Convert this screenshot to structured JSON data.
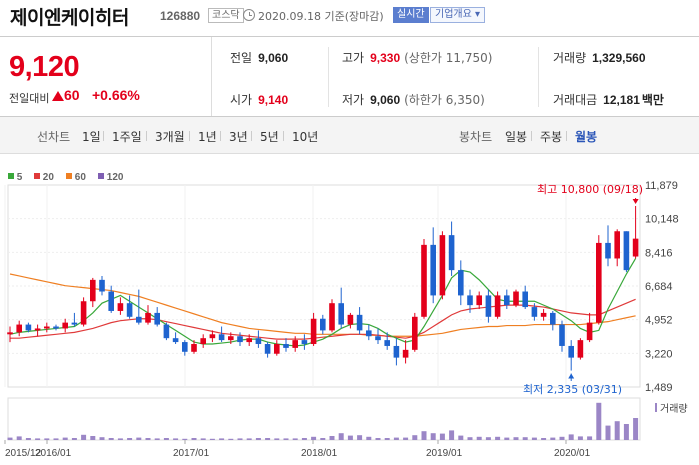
{
  "header": {
    "company_name": "제이엔케이히터",
    "stock_code": "126880",
    "market": "코스닥",
    "date_text": "2020.09.18 기준(장마감)",
    "realtime_label": "실시간",
    "overview_label": "기업개요 ▾"
  },
  "price": {
    "current": "9,120",
    "change_label": "전일대비",
    "change": "60",
    "change_pct": "+0.66%"
  },
  "stats": {
    "prev_close_label": "전일",
    "prev_close": "9,060",
    "high_label": "고가",
    "high": "9,330",
    "upper_limit": "(상한가 11,750)",
    "volume_label": "거래량",
    "volume": "1,329,560",
    "open_label": "시가",
    "open": "9,140",
    "low_label": "저가",
    "low": "9,060",
    "lower_limit": "(하한가 6,350)",
    "trade_value_label": "거래대금",
    "trade_value": "12,181",
    "trade_value_unit": "백만"
  },
  "toolbar": {
    "linechart_label": "선차트",
    "periods": [
      "1일",
      "1주일",
      "3개월",
      "1년",
      "3년",
      "5년",
      "10년"
    ],
    "candle_label": "봉차트",
    "candles": [
      "일봉",
      "주봉",
      "월봉"
    ],
    "active_candle": "월봉"
  },
  "legend": [
    {
      "label": "5",
      "color": "#39a83a"
    },
    {
      "label": "20",
      "color": "#e03a3a"
    },
    {
      "label": "60",
      "color": "#ef7f22"
    },
    {
      "label": "120",
      "color": "#7f5fb3"
    }
  ],
  "colors": {
    "up": "#e3001b",
    "down": "#1e63cf",
    "volume": "#9b86c6"
  },
  "chart_data": {
    "type": "candlestick",
    "period": "monthly",
    "ylim": [
      1489,
      11879
    ],
    "y_ticks": [
      "11,879",
      "10,148",
      "8,416",
      "6,684",
      "4,952",
      "3,220",
      "1,489"
    ],
    "x_ticks": [
      "2015/12",
      "2016/01",
      "2017/01",
      "2018/01",
      "2019/01",
      "2020/01"
    ],
    "max_annotation": "최고 10,800 (09/18)",
    "min_annotation": "최저 2,335 (03/31)",
    "volume_label": "거래량",
    "candles": [
      [
        4200,
        4600,
        3800,
        4300
      ],
      [
        4300,
        4900,
        4100,
        4700
      ],
      [
        4700,
        4800,
        4300,
        4400
      ],
      [
        4400,
        4700,
        4100,
        4500
      ],
      [
        4500,
        4800,
        4300,
        4600
      ],
      [
        4600,
        4700,
        4400,
        4500
      ],
      [
        4500,
        5000,
        4300,
        4800
      ],
      [
        4800,
        5300,
        4600,
        4700
      ],
      [
        4700,
        6100,
        4600,
        5900
      ],
      [
        5900,
        7100,
        5600,
        7000
      ],
      [
        7000,
        7200,
        6200,
        6400
      ],
      [
        6400,
        6700,
        5300,
        5400
      ],
      [
        5400,
        6100,
        5200,
        5800
      ],
      [
        5800,
        6200,
        5000,
        5100
      ],
      [
        5100,
        6500,
        4700,
        4800
      ],
      [
        4800,
        5700,
        4700,
        5300
      ],
      [
        5300,
        5600,
        4600,
        4700
      ],
      [
        4700,
        4800,
        3900,
        4000
      ],
      [
        4000,
        4300,
        3700,
        3800
      ],
      [
        3800,
        3900,
        3100,
        3300
      ],
      [
        3300,
        3900,
        3200,
        3700
      ],
      [
        3700,
        4200,
        3500,
        4000
      ],
      [
        4000,
        4400,
        3800,
        4200
      ],
      [
        4200,
        4600,
        3800,
        3900
      ],
      [
        3900,
        4300,
        3700,
        4100
      ],
      [
        4100,
        4300,
        3600,
        3800
      ],
      [
        3800,
        4200,
        3600,
        4000
      ],
      [
        4000,
        4400,
        3500,
        3700
      ],
      [
        3700,
        3800,
        3000,
        3200
      ],
      [
        3200,
        3900,
        3100,
        3700
      ],
      [
        3700,
        4000,
        3300,
        3500
      ],
      [
        3500,
        4100,
        3300,
        3900
      ],
      [
        3900,
        4200,
        3400,
        3700
      ],
      [
        3700,
        5300,
        3600,
        5000
      ],
      [
        5000,
        5200,
        4200,
        4400
      ],
      [
        4400,
        6000,
        4300,
        5800
      ],
      [
        5800,
        6600,
        4500,
        4700
      ],
      [
        4700,
        5300,
        4500,
        5200
      ],
      [
        5200,
        5600,
        4200,
        4400
      ],
      [
        4400,
        4700,
        3900,
        4100
      ],
      [
        4100,
        4500,
        3700,
        3900
      ],
      [
        3900,
        4300,
        3400,
        3600
      ],
      [
        3600,
        4000,
        2600,
        3000
      ],
      [
        3000,
        3900,
        2700,
        3400
      ],
      [
        3400,
        5300,
        3300,
        5100
      ],
      [
        5100,
        9100,
        5000,
        8800
      ],
      [
        8800,
        9700,
        5800,
        6200
      ],
      [
        6200,
        9500,
        6000,
        9300
      ],
      [
        9300,
        10000,
        7200,
        7500
      ],
      [
        7500,
        8000,
        5700,
        6200
      ],
      [
        6200,
        6500,
        5300,
        5700
      ],
      [
        5700,
        6400,
        5500,
        6200
      ],
      [
        6200,
        6500,
        4800,
        5100
      ],
      [
        5100,
        6400,
        5000,
        6200
      ],
      [
        6200,
        6500,
        5500,
        5700
      ],
      [
        5700,
        6500,
        5600,
        6400
      ],
      [
        6400,
        6700,
        5500,
        5600
      ],
      [
        5600,
        5800,
        4900,
        5100
      ],
      [
        5100,
        5500,
        4900,
        5300
      ],
      [
        5300,
        5400,
        4400,
        4700
      ],
      [
        4700,
        4900,
        3300,
        3600
      ],
      [
        3600,
        3900,
        2335,
        3000
      ],
      [
        3000,
        4000,
        2900,
        3900
      ],
      [
        3900,
        5300,
        3800,
        4800
      ],
      [
        4800,
        9300,
        4700,
        8900
      ],
      [
        8900,
        9800,
        7700,
        8100
      ],
      [
        8100,
        9600,
        7700,
        9500
      ],
      [
        9500,
        9500,
        7400,
        7500
      ],
      [
        8200,
        10800,
        8100,
        9120
      ]
    ],
    "volume": [
      0.06,
      0.09,
      0.05,
      0.04,
      0.04,
      0.04,
      0.06,
      0.05,
      0.13,
      0.1,
      0.07,
      0.05,
      0.04,
      0.05,
      0.06,
      0.05,
      0.04,
      0.05,
      0.04,
      0.03,
      0.05,
      0.04,
      0.03,
      0.04,
      0.03,
      0.04,
      0.04,
      0.05,
      0.05,
      0.04,
      0.04,
      0.04,
      0.05,
      0.08,
      0.05,
      0.1,
      0.17,
      0.11,
      0.12,
      0.08,
      0.05,
      0.05,
      0.06,
      0.06,
      0.12,
      0.22,
      0.17,
      0.16,
      0.24,
      0.11,
      0.07,
      0.08,
      0.07,
      0.08,
      0.06,
      0.07,
      0.07,
      0.06,
      0.05,
      0.06,
      0.08,
      0.14,
      0.09,
      0.09,
      0.93,
      0.36,
      0.47,
      0.4,
      0.55
    ],
    "ma5": [
      4200,
      4300,
      4350,
      4400,
      4450,
      4500,
      4550,
      4600,
      4900,
      5300,
      5800,
      6000,
      6200,
      5900,
      5600,
      5300,
      5000,
      4700,
      4400,
      4100,
      3800,
      3700,
      3700,
      3750,
      3800,
      3900,
      3950,
      3950,
      3800,
      3700,
      3650,
      3600,
      3650,
      3800,
      3950,
      4200,
      4500,
      4700,
      4750,
      4700,
      4500,
      4200,
      4000,
      3800,
      3900,
      4600,
      5400,
      6200,
      7100,
      7500,
      7400,
      7000,
      6500,
      6000,
      5900,
      5900,
      5900,
      5900,
      5700,
      5500,
      5200,
      4900,
      4500,
      4300,
      4400,
      5500,
      6400,
      7300,
      8100
    ],
    "ma20": [
      4000,
      4000,
      4050,
      4100,
      4150,
      4200,
      4250,
      4300,
      4400,
      4500,
      4650,
      4800,
      4900,
      4950,
      5000,
      5000,
      4950,
      4850,
      4750,
      4650,
      4550,
      4450,
      4350,
      4250,
      4200,
      4150,
      4100,
      4050,
      4000,
      3950,
      3950,
      3950,
      3950,
      4000,
      4050,
      4100,
      4150,
      4200,
      4200,
      4200,
      4150,
      4100,
      4050,
      4000,
      4100,
      4300,
      4600,
      4900,
      5200,
      5400,
      5500,
      5550,
      5600,
      5650,
      5700,
      5700,
      5700,
      5650,
      5600,
      5500,
      5400,
      5300,
      5250,
      5200,
      5200,
      5400,
      5600,
      5800,
      6000
    ],
    "ma60": [
      7300,
      7200,
      7100,
      7000,
      6900,
      6800,
      6700,
      6650,
      6600,
      6550,
      6500,
      6450,
      6350,
      6250,
      6150,
      6000,
      5850,
      5700,
      5550,
      5400,
      5250,
      5100,
      4950,
      4800,
      4700,
      4600,
      4500,
      4450,
      4400,
      4350,
      4300,
      4250,
      4250,
      4200,
      4200,
      4200,
      4200,
      4200,
      4200,
      4150,
      4150,
      4100,
      4100,
      4100,
      4100,
      4150,
      4200,
      4250,
      4350,
      4450,
      4500,
      4550,
      4600,
      4600,
      4650,
      4650,
      4650,
      4700,
      4700,
      4700,
      4700,
      4700,
      4700,
      4750,
      4800,
      4850,
      4950,
      5050,
      5150
    ]
  }
}
